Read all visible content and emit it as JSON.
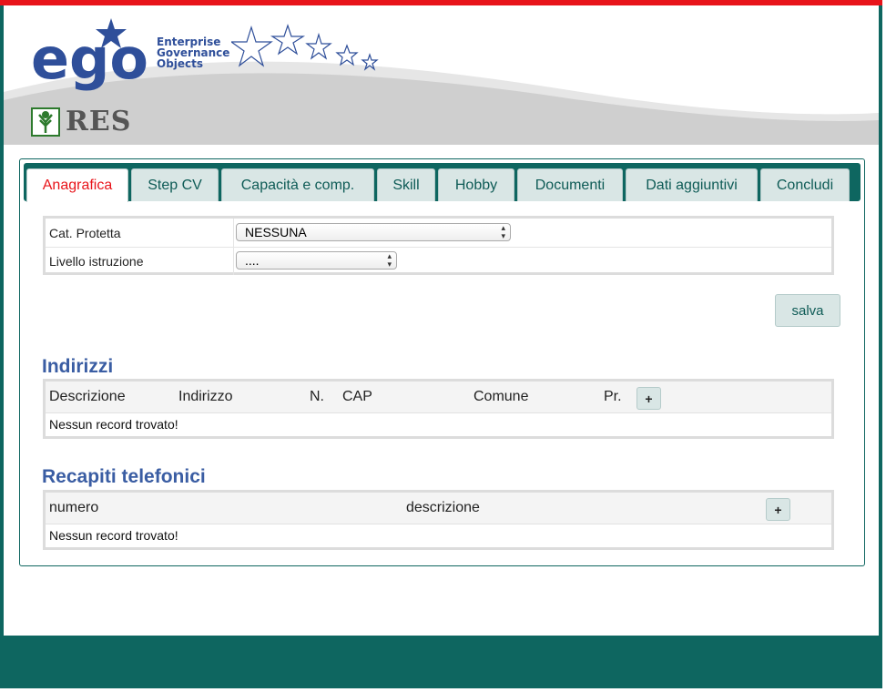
{
  "header": {
    "logo_text": "ego",
    "logo_caption": [
      "Enterprise",
      "Governance",
      "Objects"
    ],
    "res_text": "RES"
  },
  "tabs": [
    {
      "label": "Anagrafica",
      "active": true
    },
    {
      "label": "Step CV",
      "active": false
    },
    {
      "label": "Capacità e comp.",
      "active": false
    },
    {
      "label": "Skill",
      "active": false
    },
    {
      "label": "Hobby",
      "active": false
    },
    {
      "label": "Documenti",
      "active": false
    },
    {
      "label": "Dati aggiuntivi",
      "active": false
    },
    {
      "label": "Concludi",
      "active": false
    }
  ],
  "form": {
    "cat_protetta_label": "Cat. Protetta",
    "cat_protetta_value": "NESSUNA",
    "livello_label": "Livello istruzione",
    "livello_value": "...."
  },
  "save_label": "salva",
  "indirizzi": {
    "title": "Indirizzi",
    "columns": [
      "Descrizione",
      "Indirizzo",
      "N.",
      "CAP",
      "Comune",
      "Pr."
    ],
    "add_label": "+",
    "empty_text": "Nessun record trovato!"
  },
  "recapiti": {
    "title": "Recapiti telefonici",
    "columns": [
      "numero",
      "descrizione"
    ],
    "add_label": "+",
    "empty_text": "Nessun record trovato!"
  },
  "colors": {
    "accent": "#0e6660",
    "active_tab_text": "#e8141a",
    "section_title": "#3a5da3",
    "top_bar": "#e8141a"
  }
}
